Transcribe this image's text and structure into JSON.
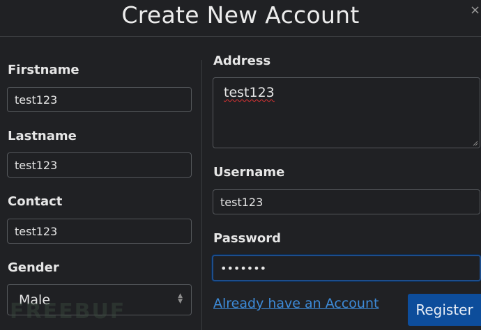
{
  "dialog": {
    "title": "Create New Account",
    "close_glyph": "×"
  },
  "left": {
    "firstname": {
      "label": "Firstname",
      "value": "test123"
    },
    "lastname": {
      "label": "Lastname",
      "value": "test123"
    },
    "contact": {
      "label": "Contact",
      "value": "test123"
    },
    "gender": {
      "label": "Gender",
      "value": "Male"
    }
  },
  "right": {
    "address": {
      "label": "Address",
      "value": "test123"
    },
    "username": {
      "label": "Username",
      "value": "test123"
    },
    "password": {
      "label": "Password",
      "value": "•••••••"
    }
  },
  "footer": {
    "login_link": "Already have an Account",
    "register_button": "Register"
  },
  "watermark": "FREEBUF",
  "colors": {
    "background": "#202124",
    "accent": "#0d4d9b",
    "link": "#3d8bd9",
    "focus_border": "#1e4e8c"
  },
  "icons": [
    "close-icon",
    "select-arrows-icon",
    "resize-handle-icon"
  ]
}
